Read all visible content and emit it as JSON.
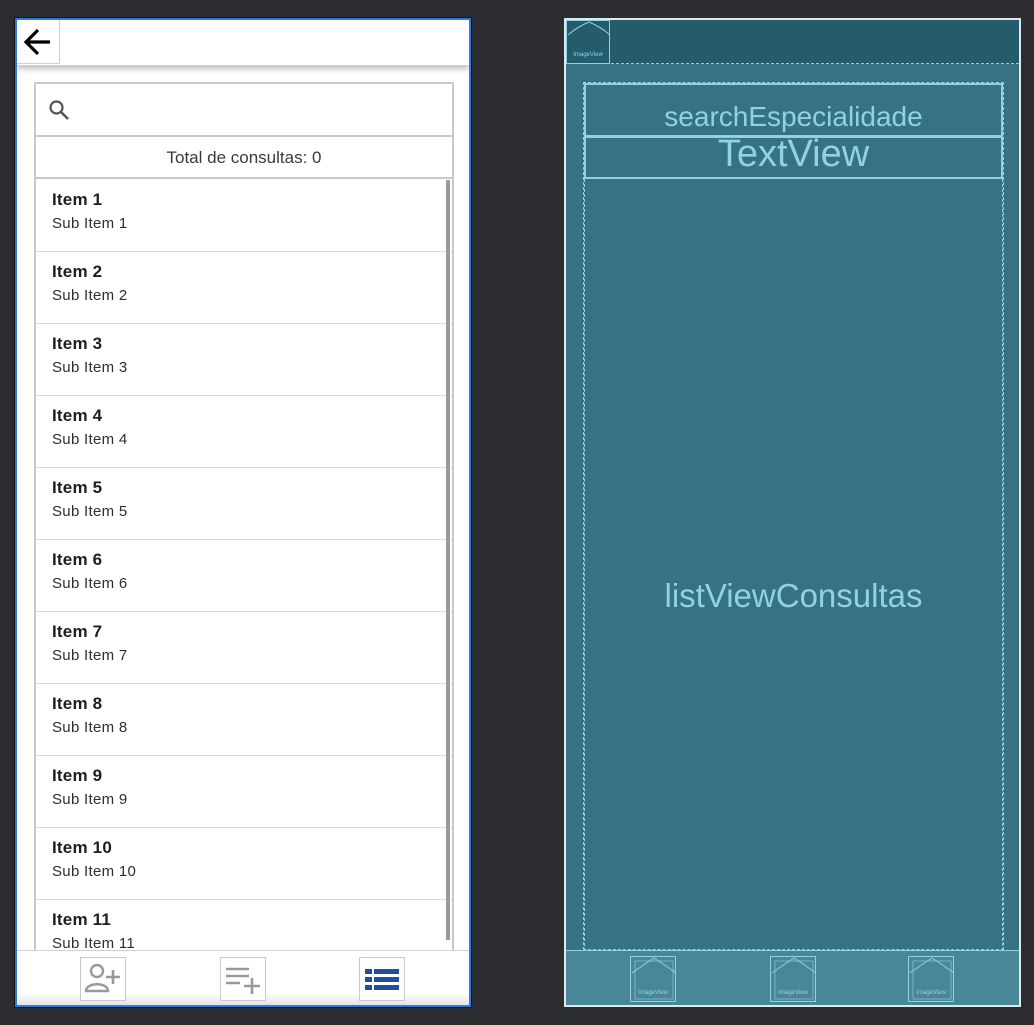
{
  "design": {
    "back_icon": "arrow-left-icon",
    "search_icon": "magnifier-icon",
    "total_label": "Total de consultas: 0",
    "items": [
      {
        "title": "Item 1",
        "subtitle": "Sub Item 1"
      },
      {
        "title": "Item 2",
        "subtitle": "Sub Item 2"
      },
      {
        "title": "Item 3",
        "subtitle": "Sub Item 3"
      },
      {
        "title": "Item 4",
        "subtitle": "Sub Item 4"
      },
      {
        "title": "Item 5",
        "subtitle": "Sub Item 5"
      },
      {
        "title": "Item 6",
        "subtitle": "Sub Item 6"
      },
      {
        "title": "Item 7",
        "subtitle": "Sub Item 7"
      },
      {
        "title": "Item 8",
        "subtitle": "Sub Item 8"
      },
      {
        "title": "Item 9",
        "subtitle": "Sub Item 9"
      },
      {
        "title": "Item 10",
        "subtitle": "Sub Item 10"
      },
      {
        "title": "Item 11",
        "subtitle": "Sub Item 11"
      }
    ],
    "nav_icons": [
      "add-person-icon",
      "add-list-icon",
      "list-icon"
    ],
    "colors": {
      "accent": "#1f4e9c",
      "selection_border": "#2d7be0"
    }
  },
  "blueprint": {
    "search_label": "searchEspecialidade",
    "text_label": "TextView",
    "list_label": "listViewConsultas",
    "image_label": "ImageView",
    "colors": {
      "background": "#377282",
      "outline": "#8fd2e0"
    }
  }
}
